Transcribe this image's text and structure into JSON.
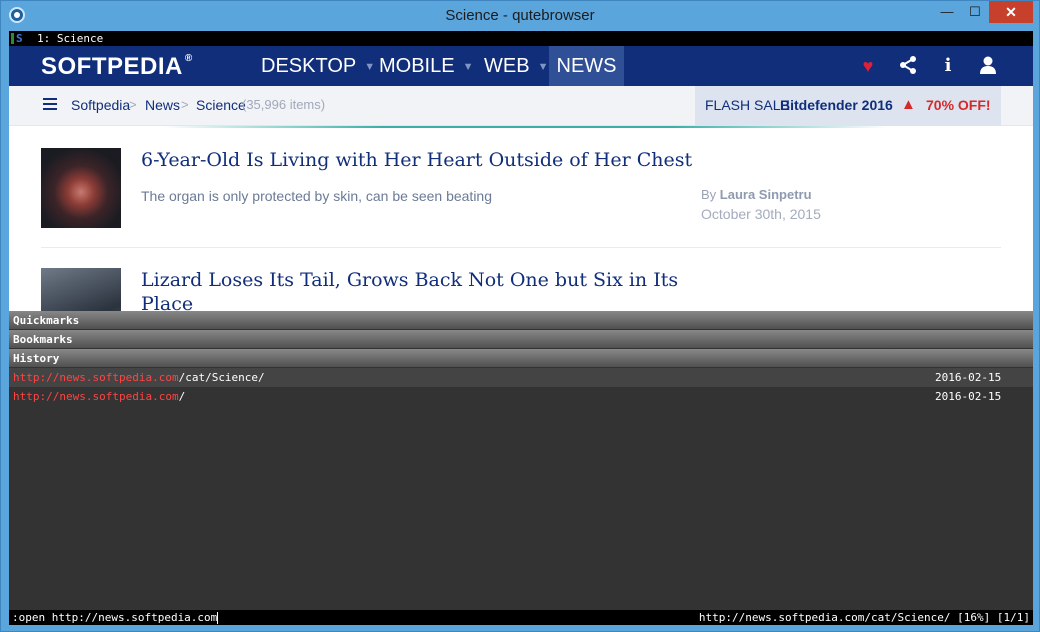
{
  "window": {
    "title": "Science - qutebrowser",
    "minimize": "—",
    "maximize": "☐",
    "close": "✕"
  },
  "tabbar": {
    "tab_label": "1: Science"
  },
  "site": {
    "logo": "SOFTPEDIA",
    "logo_mark": "®",
    "nav": [
      {
        "label": "DESKTOP",
        "caret": "▼"
      },
      {
        "label": "MOBILE",
        "caret": "▼"
      },
      {
        "label": "WEB",
        "caret": "▼"
      },
      {
        "label": "NEWS"
      }
    ],
    "icons": {
      "heart": "♥",
      "share": "⋖",
      "info": "i",
      "user": "👤"
    },
    "breadcrumb": {
      "items": [
        "Softpedia",
        "News",
        "Science"
      ],
      "sep": ">",
      "count": "(35,996 items)"
    },
    "flash_sale": {
      "label": "FLASH SALE:",
      "product": "Bitdefender 2016",
      "warn": "▲",
      "offer": "70% OFF!"
    },
    "articles": [
      {
        "title": "6-Year-Old Is Living with Her Heart Outside of Her Chest",
        "subtitle": "The organ is only protected by skin, can be seen beating",
        "by": "By",
        "author": "Laura Sinpetru",
        "date": "October 30th, 2015"
      },
      {
        "title": "Lizard Loses Its Tail, Grows Back Not One but Six in Its Place"
      }
    ]
  },
  "completion": {
    "categories": [
      "Quickmarks",
      "Bookmarks",
      "History"
    ],
    "history": [
      {
        "url_link": "http://news.softpedia.com",
        "url_rest": "/cat/Science/",
        "date": "2016-02-15"
      },
      {
        "url_link": "http://news.softpedia.com",
        "url_rest": "/",
        "date": "2016-02-15"
      }
    ]
  },
  "statusbar": {
    "command": ":open http://news.softpedia.com",
    "url_status": "http://news.softpedia.com/cat/Science/ [16%] [1/1]"
  }
}
